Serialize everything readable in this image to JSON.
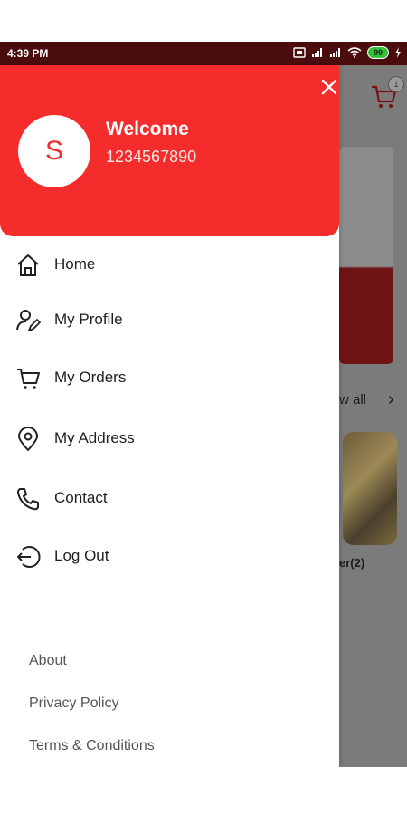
{
  "status_bar": {
    "time": "4:39 PM",
    "battery": "99",
    "icons": [
      "sim-icon",
      "signal-icon",
      "signal-icon",
      "wifi-icon",
      "battery-icon",
      "charging-icon"
    ]
  },
  "drawer": {
    "close_icon": "close-icon",
    "avatar_letter": "S",
    "welcome": "Welcome",
    "phone": "1234567890",
    "menu": [
      {
        "label": "Home",
        "icon": "home-icon"
      },
      {
        "label": "My Profile",
        "icon": "profile-edit-icon"
      },
      {
        "label": "My Orders",
        "icon": "cart-icon"
      },
      {
        "label": "My Address",
        "icon": "location-pin-icon"
      },
      {
        "label": "Contact",
        "icon": "phone-icon"
      },
      {
        "label": "Log Out",
        "icon": "logout-icon"
      }
    ],
    "footer_links": [
      "About",
      "Privacy Policy",
      "Terms & Conditions"
    ]
  },
  "background": {
    "view_all": "w all",
    "card_label": "er(2)",
    "cart_badge": "1"
  },
  "colors": {
    "accent": "#f42c2c",
    "status_bar": "#4a0c0c"
  }
}
